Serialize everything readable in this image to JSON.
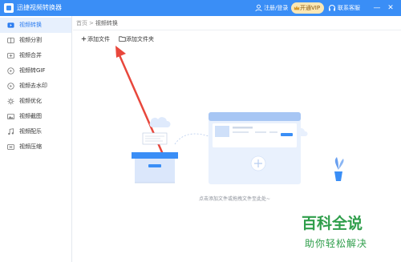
{
  "window": {
    "title": "迅捷视频转换器",
    "login_label": "注册/登录",
    "vip_label": "开通VIP",
    "support_label": "联系客服",
    "minimize_symbol": "—",
    "close_symbol": "✕",
    "accent_color": "#3a8ef6"
  },
  "sidebar": {
    "items": [
      {
        "label": "视频转换",
        "icon": "video-convert-icon",
        "active": true
      },
      {
        "label": "视频分割",
        "icon": "split-icon"
      },
      {
        "label": "视频合并",
        "icon": "merge-icon"
      },
      {
        "label": "视频转GIF",
        "icon": "gif-icon"
      },
      {
        "label": "视频去水印",
        "icon": "watermark-icon"
      },
      {
        "label": "视频优化",
        "icon": "optimize-icon"
      },
      {
        "label": "视频截图",
        "icon": "screenshot-icon"
      },
      {
        "label": "视频配乐",
        "icon": "music-icon"
      },
      {
        "label": "视频压缩",
        "icon": "compress-icon"
      }
    ]
  },
  "breadcrumb": {
    "home": "首页",
    "separator": ">",
    "current": "视频转换"
  },
  "toolbar": {
    "add_file": "添加文件",
    "add_folder": "添加文件夹"
  },
  "main": {
    "drop_hint": "点击添加文件或拖拽文件至此处~"
  },
  "watermark": {
    "title": "百科全说",
    "subtitle": "助你轻松解决"
  }
}
